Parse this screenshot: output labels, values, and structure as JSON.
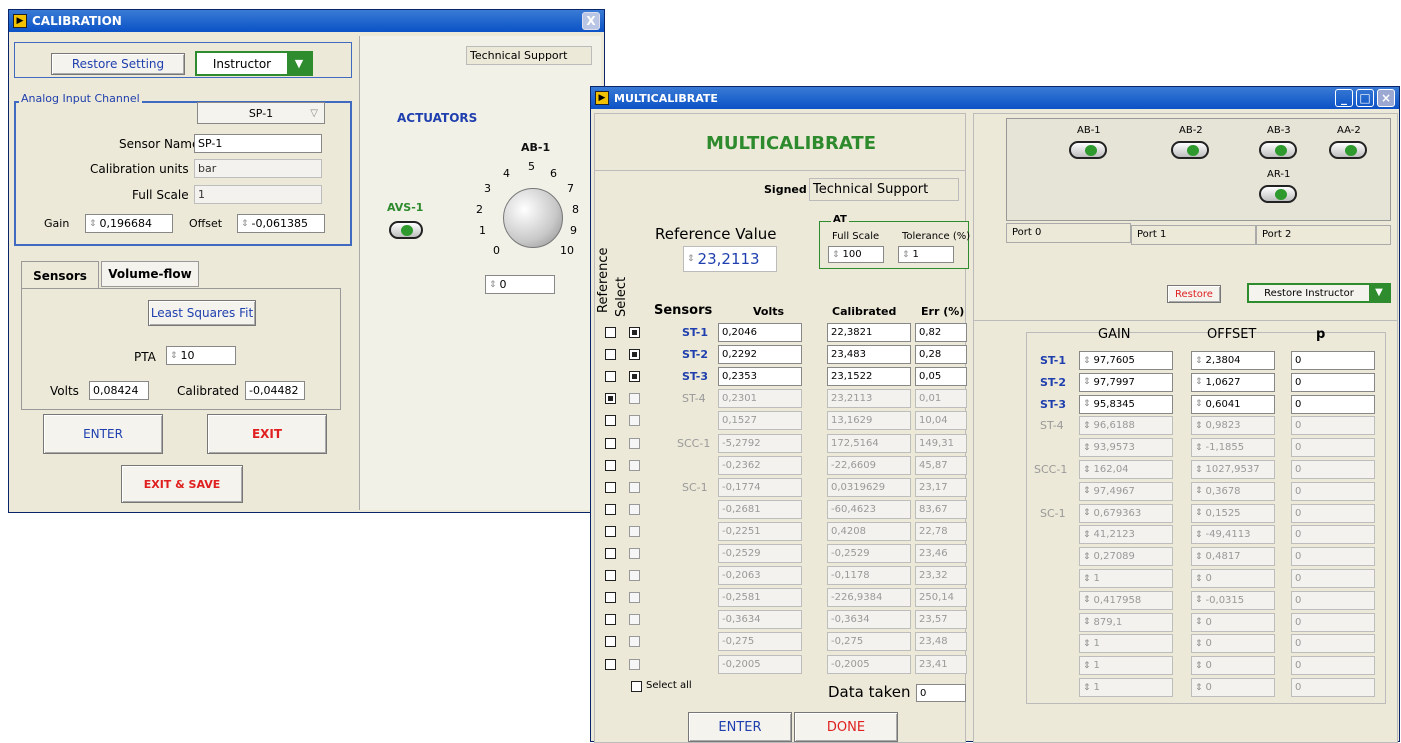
{
  "calibration": {
    "title": "CALIBRATION",
    "close": "X",
    "restore_setting": "Restore Setting",
    "user_select": "Instructor",
    "technical_support": "Technical Support",
    "analog_group": "Analog Input Channel",
    "channel": "SP-1",
    "sensor_name_label": "Sensor Name",
    "sensor_name": "SP-1",
    "units_label": "Calibration units",
    "units": "bar",
    "full_scale_label": "Full Scale",
    "full_scale": "1",
    "gain_label": "Gain",
    "gain": "0,196684",
    "offset_label": "Offset",
    "offset": "-0,061385",
    "tab_sensors": "Sensors",
    "tab_volume": "Volume-flow",
    "lsq_button": "Least Squares Fit",
    "pta_label": "PTA",
    "pta": "10",
    "volts_label": "Volts",
    "volts": "0,08424",
    "calibrated_label": "Calibrated",
    "calibrated": "-0,04482",
    "enter": "ENTER",
    "exit": "EXIT",
    "exit_save": "EXIT & SAVE",
    "actuators_title": "ACTUATORS",
    "ab1": "AB-1",
    "avs1": "AVS-1",
    "knob_ticks": [
      "0",
      "1",
      "2",
      "3",
      "4",
      "5",
      "6",
      "7",
      "8",
      "9",
      "10"
    ],
    "knob_value": "0"
  },
  "multi": {
    "title": "MULTICALIBRATE",
    "heading": "MULTICALIBRATE",
    "signed_label": "Signed",
    "signed": "Technical Support",
    "ref_label": "Reference Value",
    "ref_value": "23,2113",
    "at_label": "AT",
    "fs_label": "Full Scale",
    "fs_value": "100",
    "tol_label": "Tolerance (%)",
    "tol_value": "1",
    "col_reference": "Reference",
    "col_select": "Select",
    "col_sensors": "Sensors",
    "col_volts": "Volts",
    "col_calibrated": "Calibrated",
    "col_err": "Err (%)",
    "rows": [
      {
        "ref": false,
        "sel": true,
        "active": true,
        "name": "ST-1",
        "volts": "0,2046",
        "cal": "22,3821",
        "err": "0,82"
      },
      {
        "ref": false,
        "sel": true,
        "active": true,
        "name": "ST-2",
        "volts": "0,2292",
        "cal": "23,483",
        "err": "0,28"
      },
      {
        "ref": false,
        "sel": true,
        "active": true,
        "name": "ST-3",
        "volts": "0,2353",
        "cal": "23,1522",
        "err": "0,05"
      },
      {
        "ref": true,
        "sel": false,
        "active": false,
        "name": "ST-4",
        "volts": "0,2301",
        "cal": "23,2113",
        "err": "0,01"
      },
      {
        "ref": false,
        "sel": false,
        "active": false,
        "name": "",
        "volts": "0,1527",
        "cal": "13,1629",
        "err": "10,04"
      },
      {
        "ref": false,
        "sel": false,
        "active": false,
        "name": "SCC-1",
        "volts": "-5,2792",
        "cal": "172,5164",
        "err": "149,31"
      },
      {
        "ref": false,
        "sel": false,
        "active": false,
        "name": "",
        "volts": "-0,2362",
        "cal": "-22,6609",
        "err": "45,87"
      },
      {
        "ref": false,
        "sel": false,
        "active": false,
        "name": "SC-1",
        "volts": "-0,1774",
        "cal": "0,0319629",
        "err": "23,17"
      },
      {
        "ref": false,
        "sel": false,
        "active": false,
        "name": "",
        "volts": "-0,2681",
        "cal": "-60,4623",
        "err": "83,67"
      },
      {
        "ref": false,
        "sel": false,
        "active": false,
        "name": "",
        "volts": "-0,2251",
        "cal": "0,4208",
        "err": "22,78"
      },
      {
        "ref": false,
        "sel": false,
        "active": false,
        "name": "",
        "volts": "-0,2529",
        "cal": "-0,2529",
        "err": "23,46"
      },
      {
        "ref": false,
        "sel": false,
        "active": false,
        "name": "",
        "volts": "-0,2063",
        "cal": "-0,1178",
        "err": "23,32"
      },
      {
        "ref": false,
        "sel": false,
        "active": false,
        "name": "",
        "volts": "-0,2581",
        "cal": "-226,9384",
        "err": "250,14"
      },
      {
        "ref": false,
        "sel": false,
        "active": false,
        "name": "",
        "volts": "-0,3634",
        "cal": "-0,3634",
        "err": "23,57"
      },
      {
        "ref": false,
        "sel": false,
        "active": false,
        "name": "",
        "volts": "-0,275",
        "cal": "-0,275",
        "err": "23,48"
      },
      {
        "ref": false,
        "sel": false,
        "active": false,
        "name": "",
        "volts": "-0,2005",
        "cal": "-0,2005",
        "err": "23,41"
      }
    ],
    "select_all": "Select all",
    "data_taken_label": "Data taken",
    "data_taken": "0",
    "enter": "ENTER",
    "done": "DONE",
    "ports_buttons": [
      "AB-1",
      "AB-2",
      "AB-3",
      "AA-2",
      "AR-1"
    ],
    "ports": [
      "Port 0",
      "Port 1",
      "Port 2"
    ],
    "restore": "Restore",
    "restore_instructor": "Restore Instructor",
    "col_gain": "GAIN",
    "col_offset": "OFFSET",
    "col_p": "p",
    "grows": [
      {
        "active": true,
        "name": "ST-1",
        "gain": "97,7605",
        "offset": "2,3804",
        "p": "0"
      },
      {
        "active": true,
        "name": "ST-2",
        "gain": "97,7997",
        "offset": "1,0627",
        "p": "0"
      },
      {
        "active": true,
        "name": "ST-3",
        "gain": "95,8345",
        "offset": "0,6041",
        "p": "0"
      },
      {
        "active": false,
        "name": "ST-4",
        "gain": "96,6188",
        "offset": "0,9823",
        "p": "0"
      },
      {
        "active": false,
        "name": "",
        "gain": "93,9573",
        "offset": "-1,1855",
        "p": "0"
      },
      {
        "active": false,
        "name": "SCC-1",
        "gain": "162,04",
        "offset": "1027,9537",
        "p": "0"
      },
      {
        "active": false,
        "name": "",
        "gain": "97,4967",
        "offset": "0,3678",
        "p": "0"
      },
      {
        "active": false,
        "name": "SC-1",
        "gain": "0,679363",
        "offset": "0,1525",
        "p": "0"
      },
      {
        "active": false,
        "name": "",
        "gain": "41,2123",
        "offset": "-49,4113",
        "p": "0"
      },
      {
        "active": false,
        "name": "",
        "gain": "0,27089",
        "offset": "0,4817",
        "p": "0"
      },
      {
        "active": false,
        "name": "",
        "gain": "1",
        "offset": "0",
        "p": "0"
      },
      {
        "active": false,
        "name": "",
        "gain": "0,417958",
        "offset": "-0,0315",
        "p": "0"
      },
      {
        "active": false,
        "name": "",
        "gain": "879,1",
        "offset": "0",
        "p": "0"
      },
      {
        "active": false,
        "name": "",
        "gain": "1",
        "offset": "0",
        "p": "0"
      },
      {
        "active": false,
        "name": "",
        "gain": "1",
        "offset": "0",
        "p": "0"
      },
      {
        "active": false,
        "name": "",
        "gain": "1",
        "offset": "0",
        "p": "0"
      }
    ]
  }
}
